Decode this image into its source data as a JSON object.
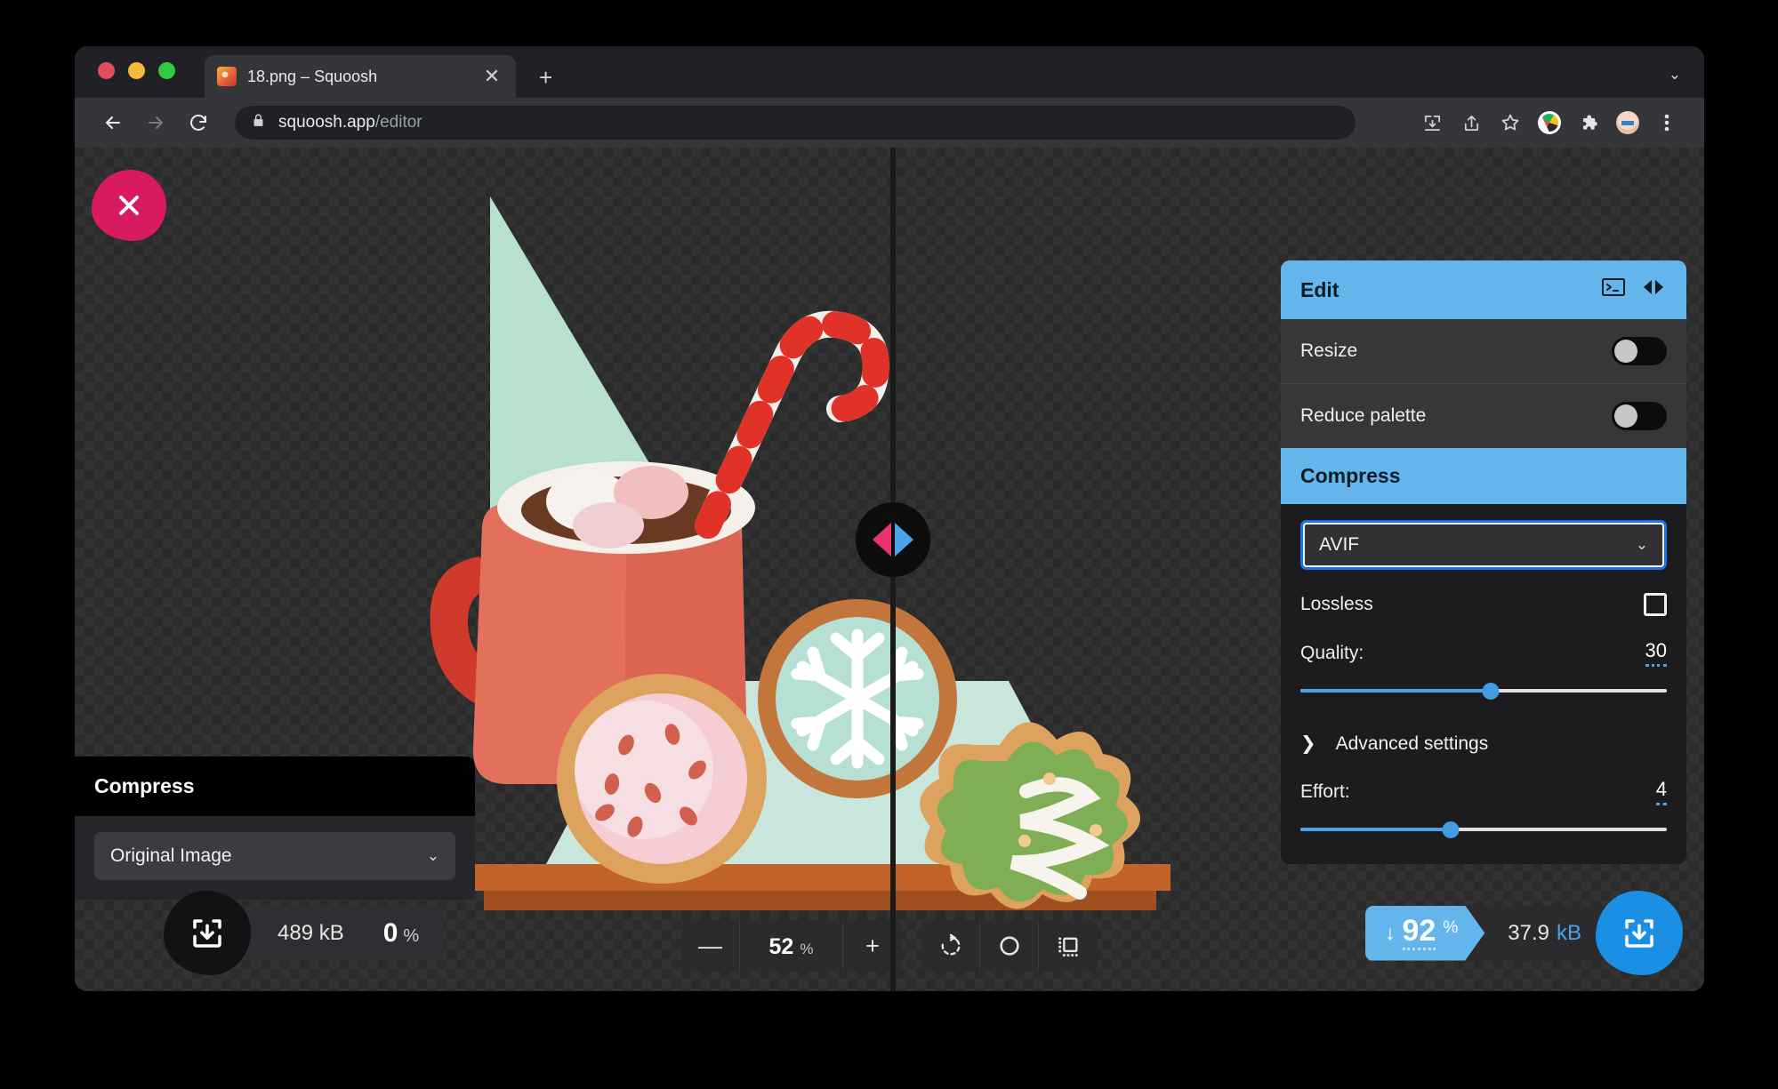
{
  "browser": {
    "tab": {
      "title": "18.png – Squoosh",
      "favicon": "squoosh-favicon",
      "close_label": "✕"
    },
    "new_tab_label": "+",
    "tabstrip_chevron": "⌄",
    "omnibox": {
      "lock_icon": "lock-icon",
      "host": "squoosh.app",
      "path": "/editor"
    },
    "toolbar_icons": [
      "install-app-icon",
      "share-icon",
      "bookmark-star-icon",
      "color-wheel-extension-icon",
      "extensions-puzzle-icon",
      "profile-avatar-icon",
      "browser-menu-icon"
    ],
    "traffic_lights": [
      "#e24b5f",
      "#f5b93c",
      "#2fc942"
    ]
  },
  "app": {
    "close_button_label": "✕",
    "split_handle": {
      "left_color": "#e8336d",
      "right_color": "#4aa3e8"
    },
    "left_panel": {
      "header": "Compress",
      "select_value": "Original Image",
      "select_chevron": "⌄",
      "download_icon": "download-icon",
      "size": "489 kB",
      "percent": "0",
      "percent_sign": "%"
    },
    "zoom_bar": {
      "minus_label": "—",
      "value": "52",
      "percent_sign": "%",
      "plus_label": "+",
      "rotate_icon": "rotate-icon",
      "original_icon": "toggle-original-circle-icon",
      "background_icon": "toggle-background-icon"
    },
    "right_panel": {
      "edit": {
        "title": "Edit",
        "console_icon": "terminal-icon",
        "swap_icon": "swap-left-right-icon",
        "rows": [
          {
            "label": "Resize",
            "enabled": false
          },
          {
            "label": "Reduce palette",
            "enabled": false
          }
        ]
      },
      "compress": {
        "title": "Compress",
        "codec": "AVIF",
        "codec_chevron": "⌄",
        "lossless_label": "Lossless",
        "lossless_checked": false,
        "quality_label": "Quality:",
        "quality_value": "30",
        "quality_pct": 52,
        "advanced_label": "Advanced settings",
        "advanced_chevron": "❯",
        "effort_label": "Effort:",
        "effort_value": "4",
        "effort_pct": 41
      }
    },
    "result": {
      "arrow": "↓",
      "percent": "92",
      "percent_sign": "%",
      "size": "37.9",
      "unit": "kB",
      "download_icon": "download-icon"
    }
  },
  "colors": {
    "accent_blue": "#64b5ec",
    "download_blue": "#1a8fe3",
    "close_pink": "#d81b60",
    "focus_blue": "#1a73e8"
  }
}
